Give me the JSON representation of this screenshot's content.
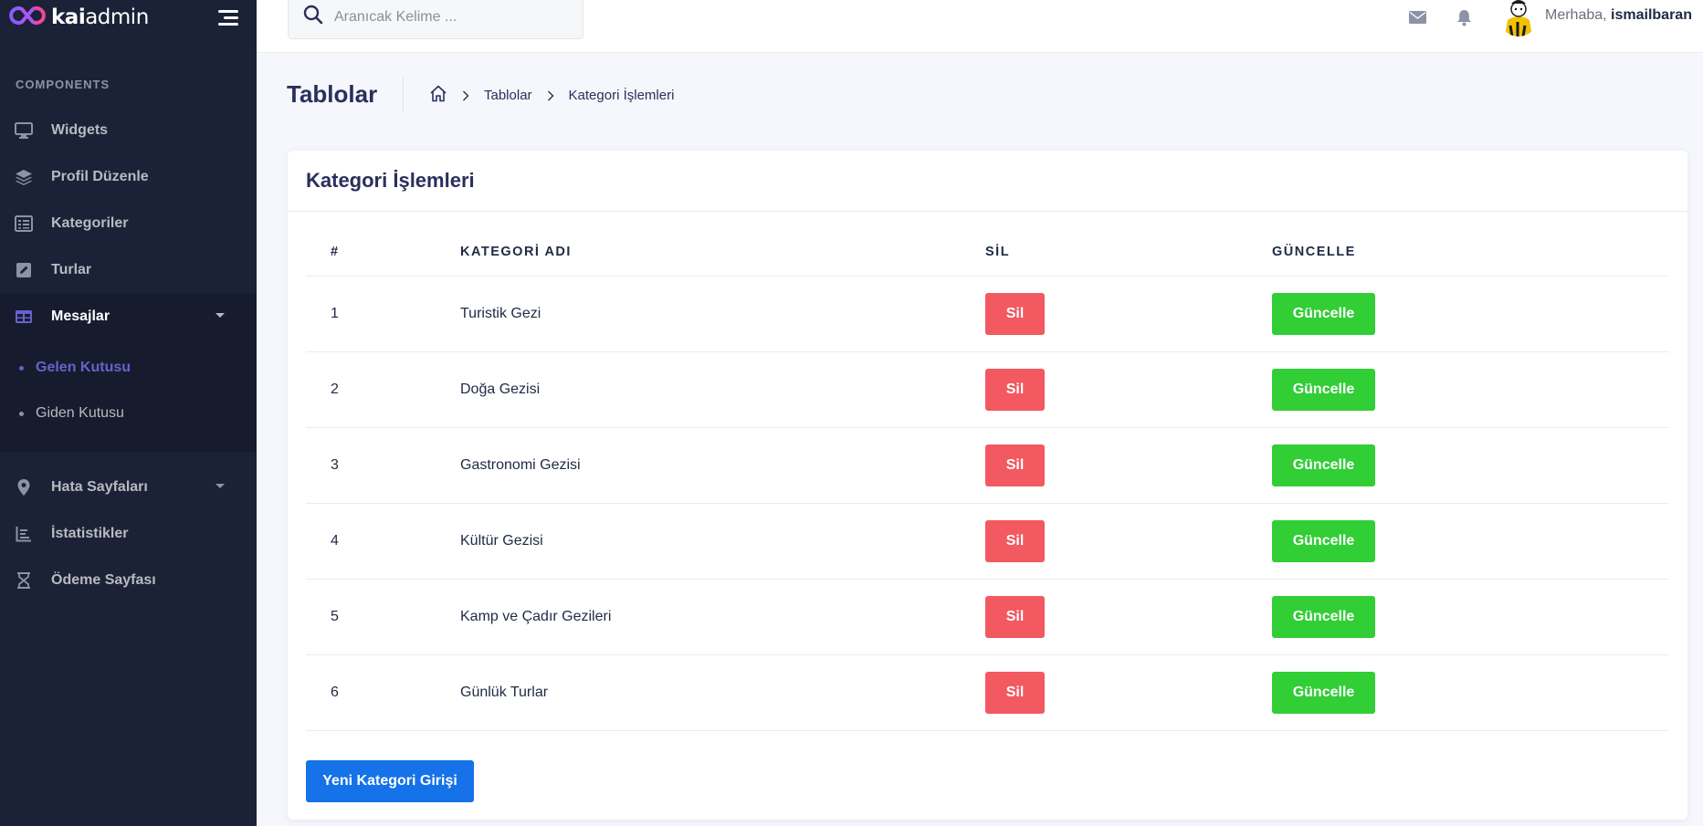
{
  "sidebar": {
    "logo": {
      "prefix": "kai",
      "suffix": "admin"
    },
    "section_title": "COMPONENTS",
    "items": [
      {
        "label": "Widgets",
        "icon": "desktop-icon"
      },
      {
        "label": "Profil Düzenle",
        "icon": "layers-icon"
      },
      {
        "label": "Kategoriler",
        "icon": "list-table-icon"
      },
      {
        "label": "Turlar",
        "icon": "pen-square-icon"
      },
      {
        "label": "Mesajlar",
        "icon": "table-icon",
        "active": true,
        "expanded": true
      }
    ],
    "submenu": [
      {
        "label": "Gelen Kutusu",
        "active": true
      },
      {
        "label": "Giden Kutusu"
      }
    ],
    "items2": [
      {
        "label": "Hata Sayfaları",
        "icon": "map-marker-icon"
      },
      {
        "label": "İstatistikler",
        "icon": "chart-icon"
      },
      {
        "label": "Ödeme Sayfası",
        "icon": "hourglass-icon"
      }
    ]
  },
  "topbar": {
    "search_placeholder": "Aranıcak Kelime ...",
    "greeting": "Merhaba,",
    "username": "ismailbaran"
  },
  "page": {
    "title": "Tablolar",
    "breadcrumb": [
      "Tablolar",
      "Kategori İşlemleri"
    ]
  },
  "card": {
    "title": "Kategori İşlemleri",
    "columns": [
      "#",
      "KATEGORİ ADI",
      "SİL",
      "GÜNCELLE"
    ],
    "rows": [
      {
        "id": "1",
        "name": "Turistik Gezi",
        "delete_label": "Sil",
        "update_label": "Güncelle"
      },
      {
        "id": "2",
        "name": "Doğa Gezisi",
        "delete_label": "Sil",
        "update_label": "Güncelle"
      },
      {
        "id": "3",
        "name": "Gastronomi Gezisi",
        "delete_label": "Sil",
        "update_label": "Güncelle"
      },
      {
        "id": "4",
        "name": "Kültür Gezisi",
        "delete_label": "Sil",
        "update_label": "Güncelle"
      },
      {
        "id": "5",
        "name": "Kamp ve Çadır Gezileri",
        "delete_label": "Sil",
        "update_label": "Güncelle"
      },
      {
        "id": "6",
        "name": "Günlük Turlar",
        "delete_label": "Sil",
        "update_label": "Güncelle"
      }
    ],
    "new_button_label": "Yeni Kategori Girişi"
  },
  "colors": {
    "sidebar_bg": "#1b2238",
    "accent": "#6861ce",
    "danger": "#f25961",
    "success": "#31ce36",
    "primary": "#1572e8"
  }
}
